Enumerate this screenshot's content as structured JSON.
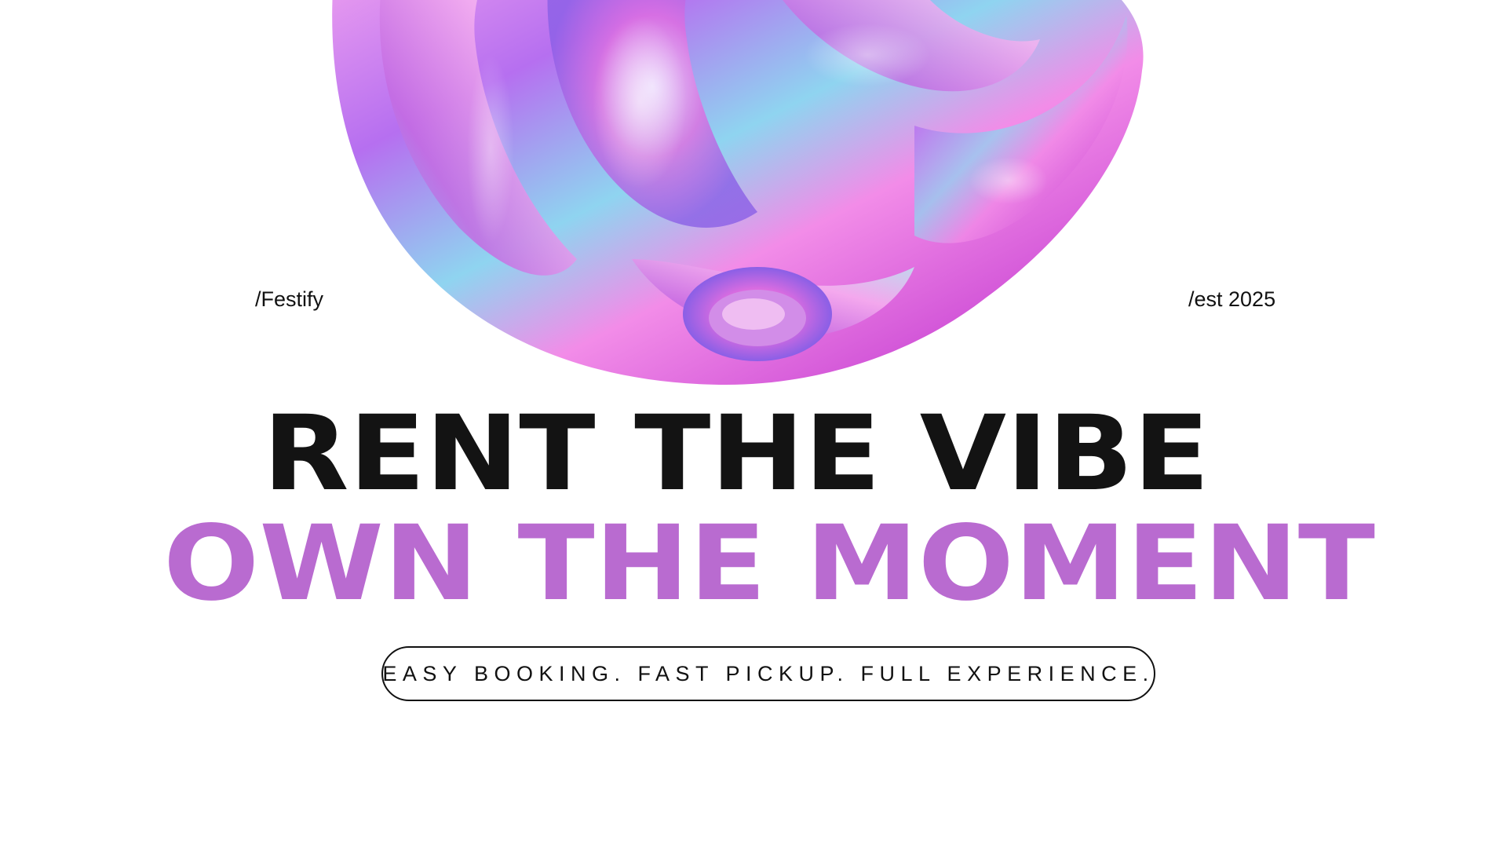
{
  "brand": "/Festify",
  "established": "/est 2025",
  "headline": {
    "line1": "RENT THE VIBE",
    "line2": "OWN THE MOMENT"
  },
  "tagline": "EASY BOOKING. FAST PICKUP. FULL EXPERIENCE.",
  "colors": {
    "background": "#ffffff",
    "primary_text": "#131313",
    "accent": "#b96bd0"
  },
  "decoration": "iridescent-holographic-blob"
}
